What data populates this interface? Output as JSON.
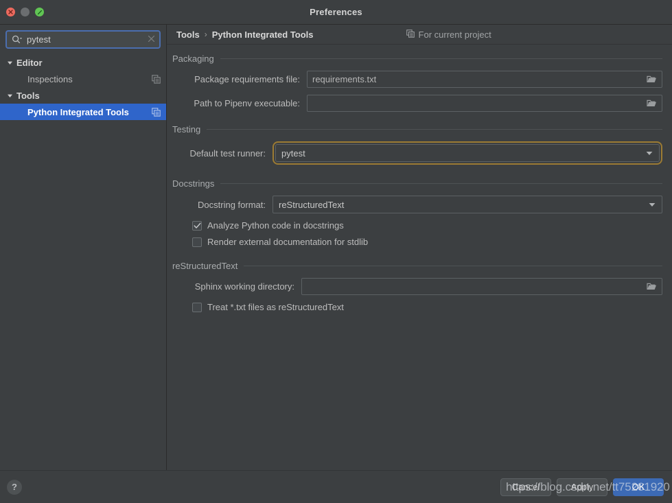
{
  "window": {
    "title": "Preferences",
    "controls": {
      "close": "close",
      "minimize": "minimize",
      "zoom": "zoom"
    }
  },
  "sidebar": {
    "search": {
      "value": "pytest",
      "placeholder": "",
      "icon": "search-icon",
      "clear_icon": "close-icon"
    },
    "tree": [
      {
        "label": "Editor",
        "type": "group",
        "arrow": "▼",
        "selected": false,
        "has_copy_icon": false
      },
      {
        "label": "Inspections",
        "type": "child",
        "arrow": "",
        "selected": false,
        "has_copy_icon": true
      },
      {
        "label": "Tools",
        "type": "group",
        "arrow": "▼",
        "selected": false,
        "has_copy_icon": false
      },
      {
        "label": "Python Integrated Tools",
        "type": "child",
        "arrow": "",
        "selected": true,
        "has_copy_icon": true
      }
    ]
  },
  "breadcrumb": {
    "parent": "Tools",
    "separator": "›",
    "current": "Python Integrated Tools",
    "scope_label": "For current project",
    "scope_icon": "copy-icon"
  },
  "sections": {
    "packaging": {
      "title": "Packaging",
      "requirements": {
        "label": "Package requirements file:",
        "value": "requirements.txt",
        "browse_icon": "folder-icon"
      },
      "pipenv": {
        "label": "Path to Pipenv executable:",
        "value": "",
        "browse_icon": "folder-icon"
      }
    },
    "testing": {
      "title": "Testing",
      "test_runner": {
        "label": "Default test runner:",
        "value": "pytest",
        "focused": true,
        "caret_icon": "chevron-down-icon"
      }
    },
    "docstrings": {
      "title": "Docstrings",
      "format": {
        "label": "Docstring format:",
        "value": "reStructuredText",
        "caret_icon": "chevron-down-icon"
      },
      "analyze": {
        "label": "Analyze Python code in docstrings",
        "checked": true
      },
      "render_external": {
        "label": "Render external documentation for stdlib",
        "checked": false
      }
    },
    "restructuredtext": {
      "title": "reStructuredText",
      "sphinx_dir": {
        "label": "Sphinx working directory:",
        "value": "",
        "browse_icon": "folder-icon"
      },
      "treat_txt": {
        "label": "Treat *.txt files as reStructuredText",
        "checked": false
      }
    }
  },
  "footer": {
    "help_label": "?",
    "cancel_label": "Cancel",
    "apply_label": "Apply",
    "ok_label": "OK"
  },
  "watermark": {
    "text": "https://blog.csdn.net/tt75281920"
  },
  "colors": {
    "window_bg": "#3c3f41",
    "selection_blue": "#2f65ca",
    "primary_button": "#3c6ab5",
    "focus_gold": "#9c7b33",
    "search_border": "#4b6eaf"
  }
}
